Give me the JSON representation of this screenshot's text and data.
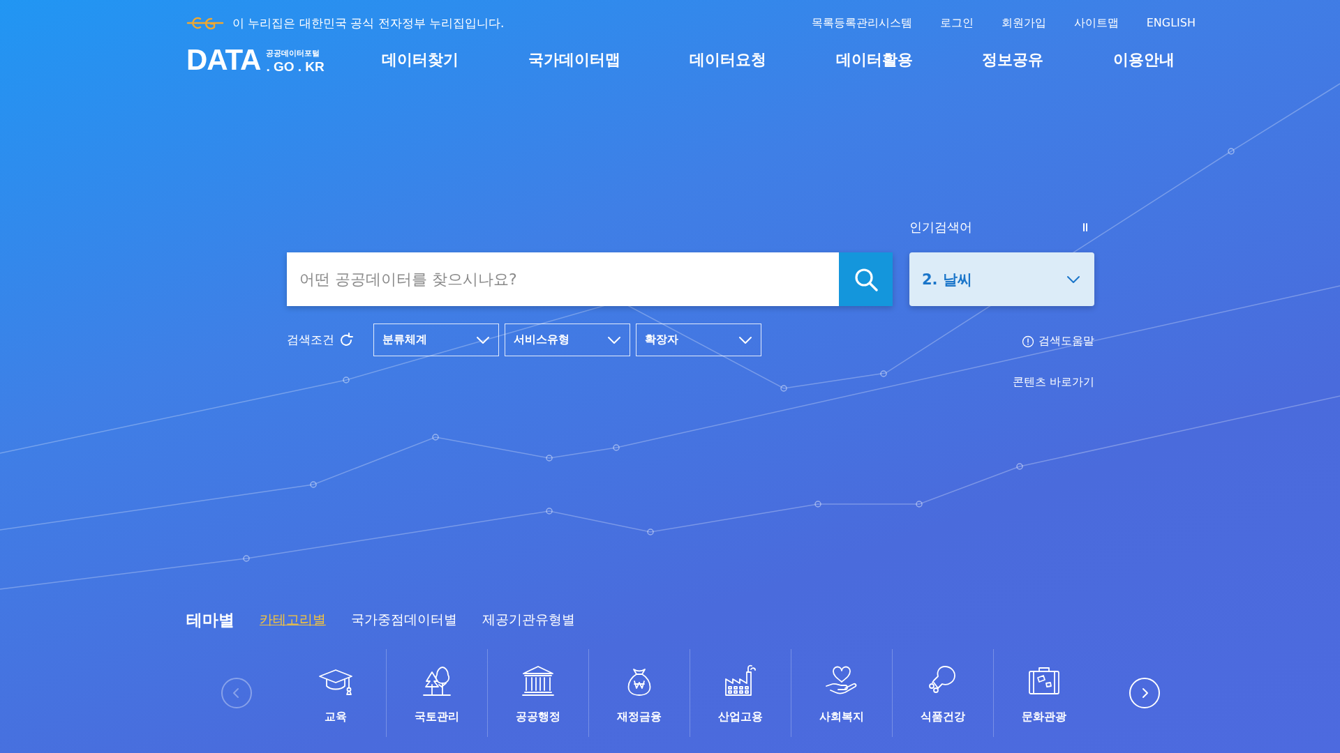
{
  "gov_banner": {
    "text": "이 누리집은 대한민국 공식 전자정부 누리집입니다."
  },
  "util_links": [
    "목록등록관리시스템",
    "로그인",
    "회원가입",
    "사이트맵",
    "ENGLISH"
  ],
  "logo": {
    "main": "DATA",
    "sub_top": "공공데이터포털",
    "sub_bottom": ". GO . KR"
  },
  "nav": [
    "데이터찾기",
    "국가데이터맵",
    "데이터요청",
    "데이터활용",
    "정보공유",
    "이용안내"
  ],
  "popular": {
    "label": "인기검색어",
    "current": "2. 날씨"
  },
  "search": {
    "placeholder": "어떤 공공데이터를 찾으시나요?"
  },
  "filters": {
    "label": "검색조건",
    "dropdowns": [
      "분류체계",
      "서비스유형",
      "확장자"
    ]
  },
  "help_link": "검색도움말",
  "content_link": "콘텐츠 바로가기",
  "theme": {
    "title": "테마별",
    "tabs": [
      {
        "label": "카테고리별",
        "selected": true
      },
      {
        "label": "국가중점데이터별",
        "selected": false
      },
      {
        "label": "제공기관유형별",
        "selected": false
      }
    ]
  },
  "carousel": {
    "prev_disabled": true,
    "next_disabled": false
  },
  "categories": [
    {
      "label": "교육",
      "kind": "cap"
    },
    {
      "label": "국토관리",
      "kind": "trees"
    },
    {
      "label": "공공행정",
      "kind": "building"
    },
    {
      "label": "재정금융",
      "kind": "moneybag"
    },
    {
      "label": "산업고용",
      "kind": "factory"
    },
    {
      "label": "사회복지",
      "kind": "hearthand"
    },
    {
      "label": "식품건강",
      "kind": "drumstick"
    },
    {
      "label": "문화관광",
      "kind": "suitcase"
    }
  ]
}
